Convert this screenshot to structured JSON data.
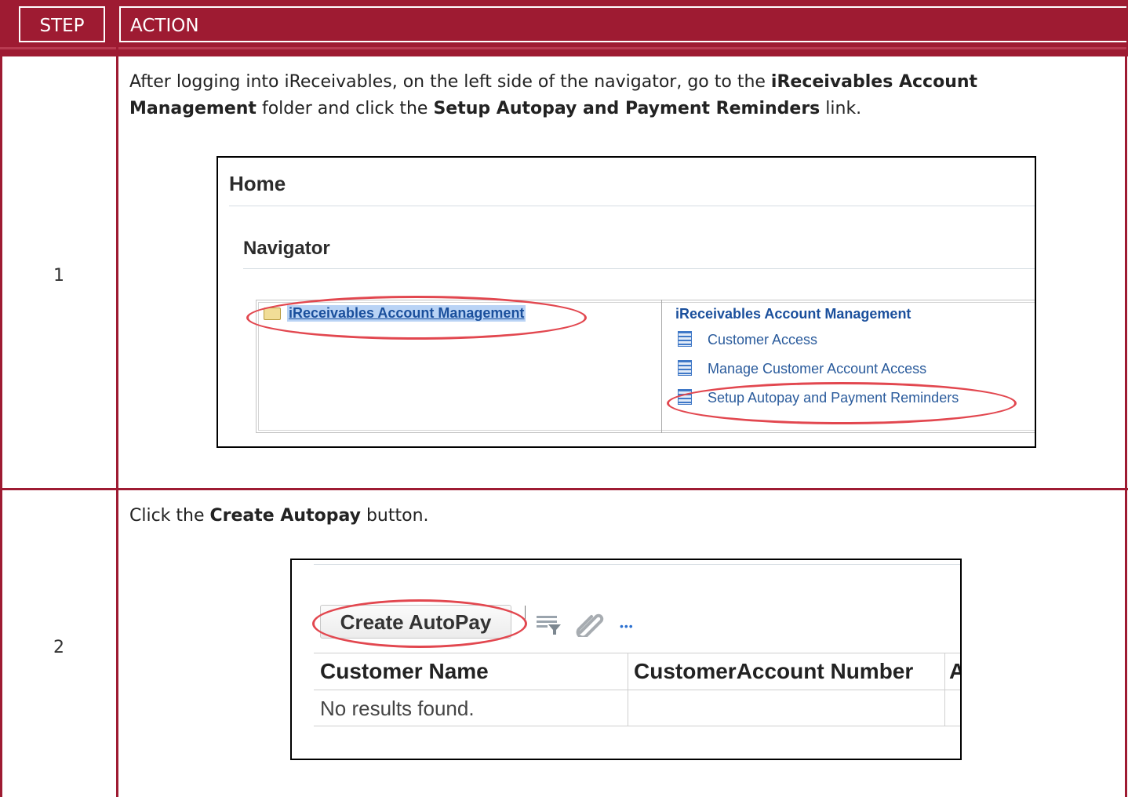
{
  "header": {
    "step_label": "STEP",
    "action_label": "ACTION"
  },
  "colors": {
    "brand": "#9e1b32",
    "highlight_ellipse": "#e2474f",
    "link": "#1a4f9c"
  },
  "steps": [
    {
      "number": "1",
      "text_1": "After logging into iReceivables, on the left side of the navigator, go to the ",
      "bold_1": "iReceivables Account Management",
      "text_2": " folder and click the ",
      "bold_2": "Setup Autopay and Payment Reminders",
      "text_3": " link.",
      "screenshot": {
        "home_title": "Home",
        "navigator_title": "Navigator",
        "folder_label": "iReceivables Account Management",
        "right_title": "iReceivables Account Management",
        "items": [
          "Customer Access",
          "Manage Customer Account Access",
          "Setup Autopay and Payment Reminders"
        ]
      }
    },
    {
      "number": "2",
      "text_1": "Click the ",
      "bold_1": "Create Autopay",
      "text_2": " button.",
      "screenshot": {
        "button_label": "Create AutoPay",
        "more_dots": "•••",
        "columns": [
          "Customer Name",
          "CustomerAccount Number",
          "A"
        ],
        "empty_text": "No results found."
      }
    }
  ]
}
